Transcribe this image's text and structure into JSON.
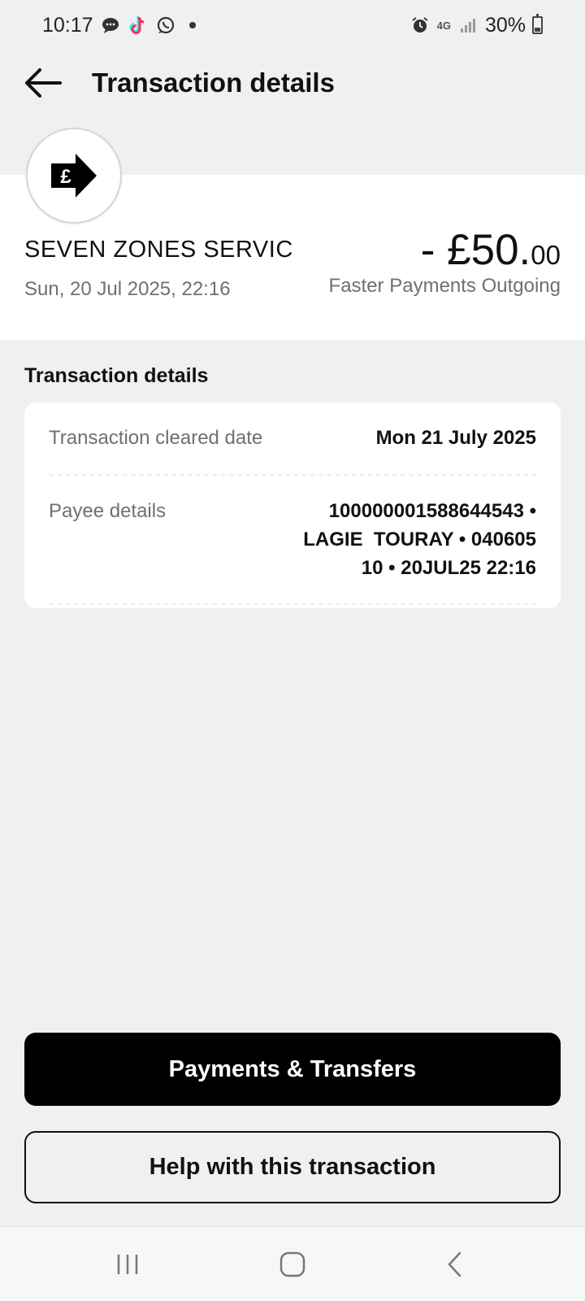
{
  "status_bar": {
    "time": "10:17",
    "battery": "30%",
    "network": "4G"
  },
  "header": {
    "title": "Transaction details"
  },
  "transaction": {
    "merchant": "SEVEN ZONES SERVIC",
    "date": "Sun, 20 Jul 2025, 22:16",
    "amount_main": "- £50.",
    "amount_pence": "00",
    "type": "Faster Payments Outgoing",
    "icon_symbol": "£"
  },
  "details": {
    "section_title": "Transaction details",
    "cleared_label": "Transaction cleared date",
    "cleared_value": "Mon 21 July 2025",
    "payee_label": "Payee details",
    "payee_line1": "100000001588644543 •",
    "payee_line2": "LAGIE  TOURAY • 040605",
    "payee_line3": "10 • 20JUL25 22:16"
  },
  "actions": {
    "primary_label": "Payments & Transfers",
    "secondary_label": "Help with this transaction"
  },
  "colors": {
    "background": "#f0f0f0",
    "card": "#ffffff",
    "primary": "#000000",
    "muted_text": "#707070"
  }
}
